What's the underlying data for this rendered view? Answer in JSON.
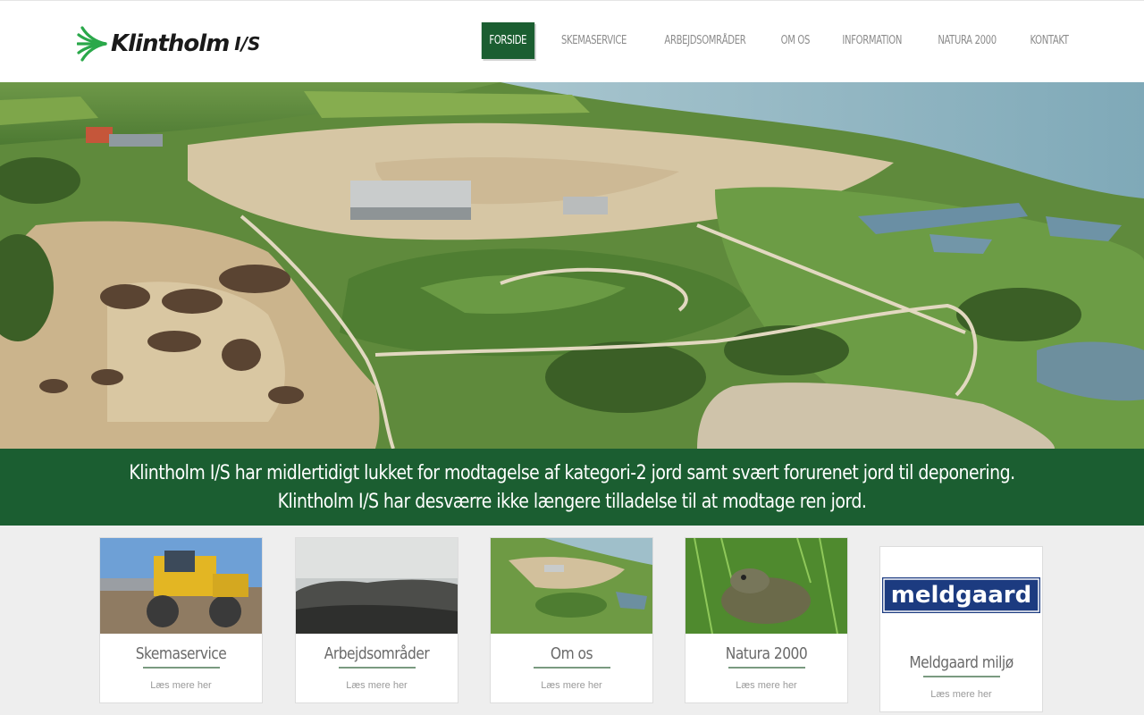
{
  "brand": {
    "name": "Klintholm",
    "suffix": "I/S",
    "colors": {
      "primary_green": "#1b5e31",
      "accent_green": "#2aa84a"
    }
  },
  "nav": {
    "items": [
      {
        "label": "FORSIDE",
        "active": true
      },
      {
        "label": "SKEMASERVICE",
        "active": false
      },
      {
        "label": "ARBEJDSOMRÅDER",
        "active": false
      },
      {
        "label": "OM OS",
        "active": false
      },
      {
        "label": "INFORMATION",
        "active": false
      },
      {
        "label": "NATURA 2000",
        "active": false
      },
      {
        "label": "KONTAKT",
        "active": false
      }
    ]
  },
  "notice": {
    "line1": "Klintholm I/S har midlertidigt lukket for modtagelse af kategori-2 jord samt svært forurenet jord til deponering.",
    "line2": "Klintholm I/S har desværre ikke længere tilladelse til at modtage ren jord."
  },
  "cards": [
    {
      "title": "Skemaservice",
      "link": "Læs mere her"
    },
    {
      "title": "Arbejdsområder",
      "link": "Læs mere her"
    },
    {
      "title": "Om os",
      "link": "Læs mere her"
    },
    {
      "title": "Natura 2000",
      "link": "Læs mere her"
    },
    {
      "title": "Meldgaard miljø",
      "link": "Læs mere her",
      "logo_text": "meldgaard"
    }
  ]
}
